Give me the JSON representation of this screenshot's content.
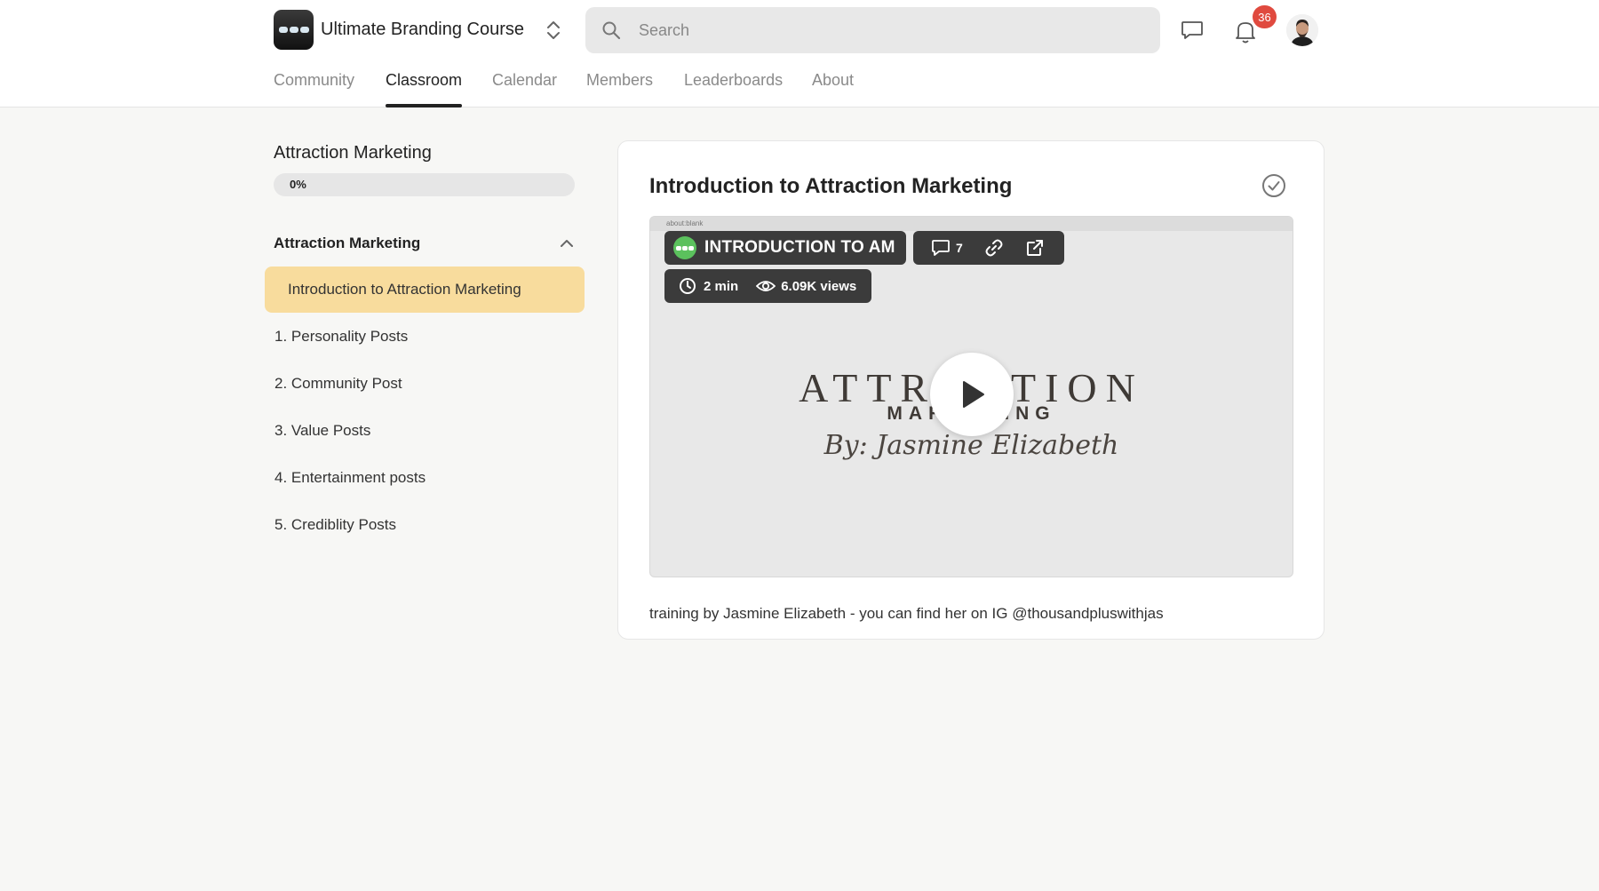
{
  "header": {
    "brand_name": "Ultimate Branding Course",
    "search_placeholder": "Search",
    "notification_count": "36"
  },
  "nav": {
    "tabs": [
      {
        "label": "Community",
        "active": false
      },
      {
        "label": "Classroom",
        "active": true
      },
      {
        "label": "Calendar",
        "active": false
      },
      {
        "label": "Members",
        "active": false
      },
      {
        "label": "Leaderboards",
        "active": false
      },
      {
        "label": "About",
        "active": false
      }
    ]
  },
  "sidebar": {
    "course_title": "Attraction Marketing",
    "progress_label": "0%",
    "progress_value": 0,
    "section_title": "Attraction Marketing",
    "lessons": [
      {
        "label": "Introduction to Attraction Marketing",
        "active": true
      },
      {
        "label": "1. Personality Posts",
        "active": false
      },
      {
        "label": "2. Community Post",
        "active": false
      },
      {
        "label": "3. Value Posts",
        "active": false
      },
      {
        "label": "4. Entertainment posts",
        "active": false
      },
      {
        "label": "5. Crediblity Posts",
        "active": false
      }
    ]
  },
  "lesson": {
    "title": "Introduction to Attraction Marketing",
    "video": {
      "topbar_text": "about:blank",
      "title": "INTRODUCTION TO AM",
      "comment_count": "7",
      "duration": "2 min",
      "views": "6.09K views",
      "art_title": "ATTRACTION",
      "art_subtitle": "MARKETING",
      "art_signature": "By: Jasmine Elizabeth"
    },
    "description": "training by Jasmine Elizabeth - you can find her on IG @thousandpluswithjas"
  },
  "colors": {
    "active_lesson_bg": "#f8dc9d",
    "badge": "#e04a3f",
    "accent_green": "#5bc15d"
  }
}
